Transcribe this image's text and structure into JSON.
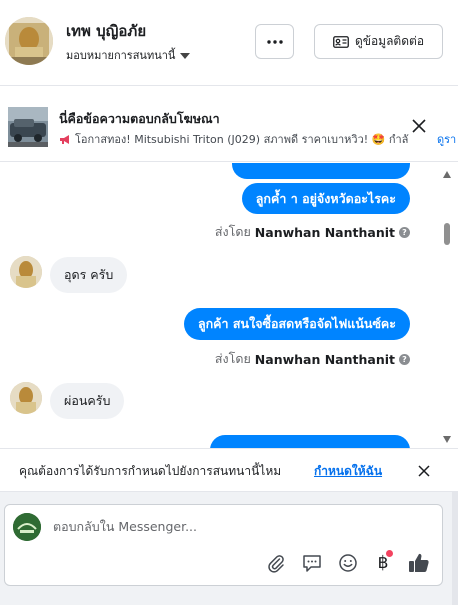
{
  "header": {
    "contact_name": "เทพ บุญิอภัย",
    "assignment_label": "มอบหมายการสนทนานี้",
    "more_label": "···",
    "contact_info_label": "ดูข้อมูลติดต่อ"
  },
  "ad_banner": {
    "title": "นี่คือข้อความตอบกลับโฆษณา",
    "snippet": "โอกาสทอง! Mitsubishi Triton (J029) สภาพดี ราคาเบาหวิว! 🤩 กำลั",
    "more_link": "ดูรา"
  },
  "messages": [
    {
      "direction": "out",
      "text": "ลูกค้ำ า อยู่จังหวัดอะไรคะ"
    },
    {
      "direction": "meta",
      "prefix": "ส่งโดย",
      "sender": "Nanwhan Nanthanit"
    },
    {
      "direction": "in",
      "text": "อุดร ครับ"
    },
    {
      "direction": "out",
      "text": "ลูกค้า สนใจซื้อสดหรือจัดไฟแน้นซ์คะ"
    },
    {
      "direction": "meta",
      "prefix": "ส่งโดย",
      "sender": "Nanwhan Nanthanit"
    },
    {
      "direction": "in",
      "text": "ผ่อนครับ"
    }
  ],
  "assign_prompt": {
    "text": "คุณต้องการได้รับการกำหนดไปยังการสนทนานี้ไหม",
    "link": "กำหนดให้ฉัน"
  },
  "composer": {
    "placeholder": "ตอบกลับใน Messenger...",
    "tools": [
      "paperclip-icon",
      "speech-bubble-icon",
      "smiley-icon",
      "baht-icon",
      "thumbs-up-icon"
    ],
    "baht_symbol": "฿"
  },
  "colors": {
    "outgoing_bubble": "#0084ff",
    "incoming_bubble": "#f0f2f5",
    "link": "#0571ed",
    "notification_dot": "#f3425f"
  }
}
